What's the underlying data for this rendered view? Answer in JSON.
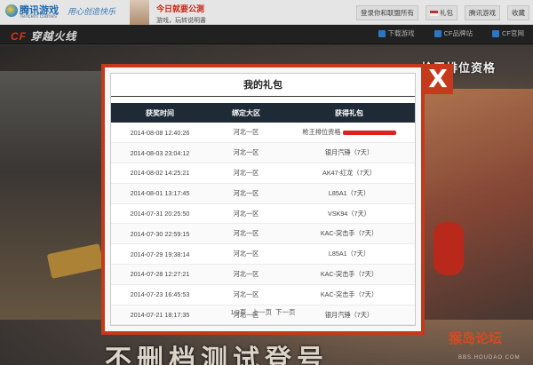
{
  "header": {
    "tencent_logo_cn": "腾讯游戏",
    "tencent_logo_en": "Tencent Games",
    "slogan": "用心创造快乐",
    "promo_title": "今日就要公測",
    "promo_sub": "游戏，玩转说明書",
    "nav": [
      {
        "label": "登录你和联盟所有"
      },
      {
        "label": "礼包"
      },
      {
        "label": "腾讯游戏"
      },
      {
        "label": "收藏"
      }
    ]
  },
  "gamenav": {
    "logo": "穿越火线",
    "links": [
      {
        "label": "下载游戏"
      },
      {
        "label": "CF品牌站"
      },
      {
        "label": "CF官网"
      }
    ]
  },
  "background": {
    "rank_title": "枪王排位资格",
    "big_slogan": "不删档测试登号",
    "watermark": "猴岛论坛",
    "watermark_url": "BBS.HOUDAO.COM"
  },
  "modal": {
    "title": "我的礼包",
    "close_label": "X",
    "columns": [
      "获奖时间",
      "绑定大区",
      "获得礼包"
    ],
    "rows": [
      {
        "time": "2014-08-08 12:40:26",
        "zone": "河北一区",
        "gift": "枪王排位资格"
      },
      {
        "time": "2014-08-03 23:04:12",
        "zone": "河北一区",
        "gift": "银月汽锤（7天）"
      },
      {
        "time": "2014-08-02 14:25:21",
        "zone": "河北一区",
        "gift": "AK47-红龙（7天）"
      },
      {
        "time": "2014-08-01 13:17:45",
        "zone": "河北一区",
        "gift": "L85A1（7天）"
      },
      {
        "time": "2014-07-31 20:25:50",
        "zone": "河北一区",
        "gift": "VSK94（7天）"
      },
      {
        "time": "2014-07-30 22:59:15",
        "zone": "河北一区",
        "gift": "KAC-突击手（7天）"
      },
      {
        "time": "2014-07-29 19:38:14",
        "zone": "河北一区",
        "gift": "L85A1（7天）"
      },
      {
        "time": "2014-07-28 12:27:21",
        "zone": "河北一区",
        "gift": "KAC-突击手（7天）"
      },
      {
        "time": "2014-07-23 16:45:53",
        "zone": "河北一区",
        "gift": "KAC-突击手（7天）"
      },
      {
        "time": "2014-07-21 18:17:35",
        "zone": "河北一区",
        "gift": "银月汽锤（7天）"
      }
    ],
    "pager": {
      "page_info": "1/2页",
      "prev": "上一页",
      "next": "下一页"
    }
  },
  "colors": {
    "modal_border": "#c43a1a",
    "table_header": "#1e2a36",
    "redaction": "#e0201a"
  }
}
